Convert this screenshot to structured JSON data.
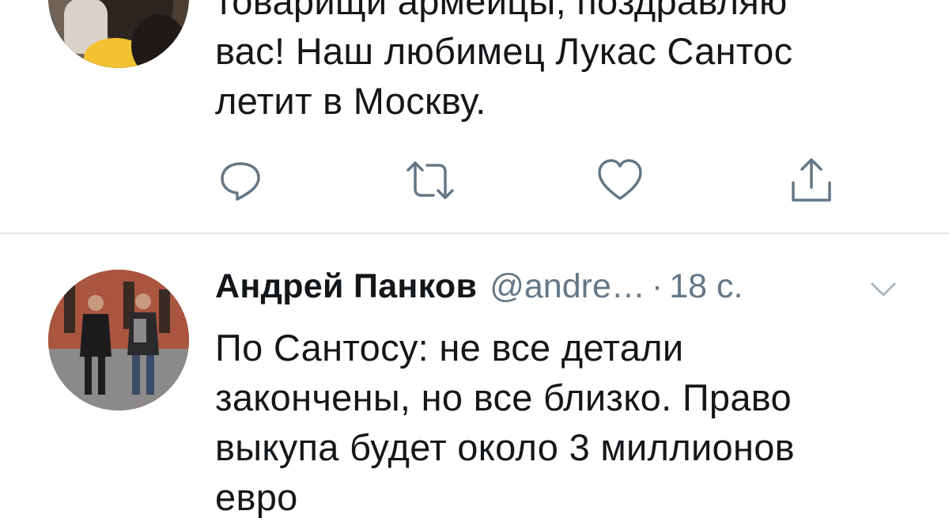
{
  "tweet1": {
    "text_lines": [
      "товарищи армейцы, поздравляю",
      "вас! Наш любимец Лукас Сантос",
      "летит в Москву."
    ]
  },
  "actions": {
    "reply_icon": "reply-icon",
    "retweet_icon": "retweet-icon",
    "like_icon": "heart-icon",
    "share_icon": "share-icon",
    "icon_color": "#657786"
  },
  "tweet2": {
    "author_name": "Андрей Панков",
    "author_handle": "@andre…",
    "separator": "·",
    "timestamp": "18 с.",
    "text_lines": [
      "По Сантосу: не все детали",
      "закончены, но все близко. Право",
      "выкупа будет около 3 миллионов",
      "евро"
    ]
  },
  "colors": {
    "primary_text": "#14171a",
    "secondary_text": "#657786",
    "divider": "#e1e8ed"
  }
}
